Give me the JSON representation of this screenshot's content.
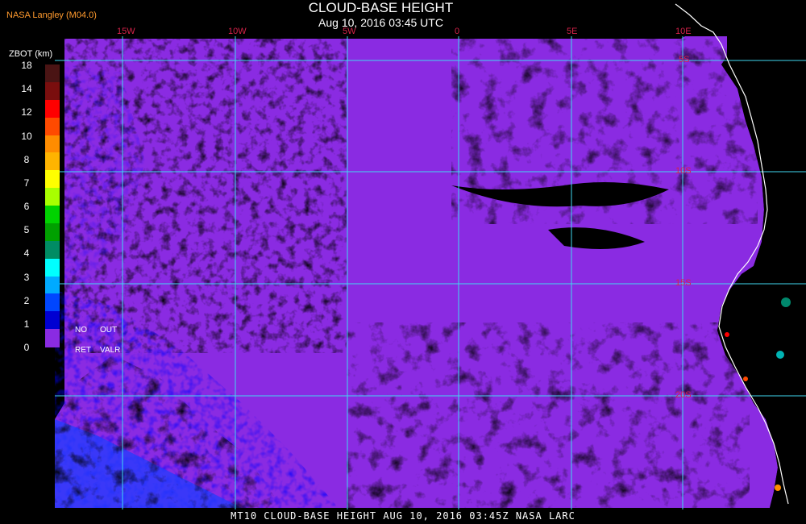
{
  "header": {
    "title": "CLOUD-BASE HEIGHT",
    "subtitle": "Aug 10, 2016 03:45 UTC",
    "credit": "NASA Langley (M04.0)"
  },
  "footer": {
    "text": "MT10  CLOUD-BASE HEIGHT   AUG 10, 2016 03:45Z   NASA LARC"
  },
  "legend": {
    "unit": "ZBOT (km)",
    "ticks": [
      "18",
      "14",
      "12",
      "10",
      "8",
      "7",
      "6",
      "5",
      "4",
      "3",
      "2",
      "1",
      "0"
    ],
    "colors": [
      "#4a1414",
      "#7a0e0e",
      "#ff0000",
      "#ff4a00",
      "#ff8c00",
      "#ffb400",
      "#ffff00",
      "#a8ff00",
      "#00d200",
      "#00a000",
      "#008c64",
      "#00ffff",
      "#00aaff",
      "#0046ff",
      "#0000d2",
      "#8a2be2"
    ],
    "no_ret": [
      "NO",
      "RET"
    ],
    "out_valr": [
      "OUT",
      "VALR"
    ]
  },
  "grid": {
    "lon_labels": [
      "15W",
      "10W",
      "5W",
      "0",
      "5E",
      "10E"
    ],
    "lat_labels": [
      "5S",
      "10S",
      "15S",
      "20S"
    ],
    "line_color": "#40d8f0",
    "coast_color": "#ffffff"
  },
  "palette": {
    "low_cloud": "#8a2be2",
    "mid_cloud": "#0000ff",
    "clear": "#000000"
  }
}
